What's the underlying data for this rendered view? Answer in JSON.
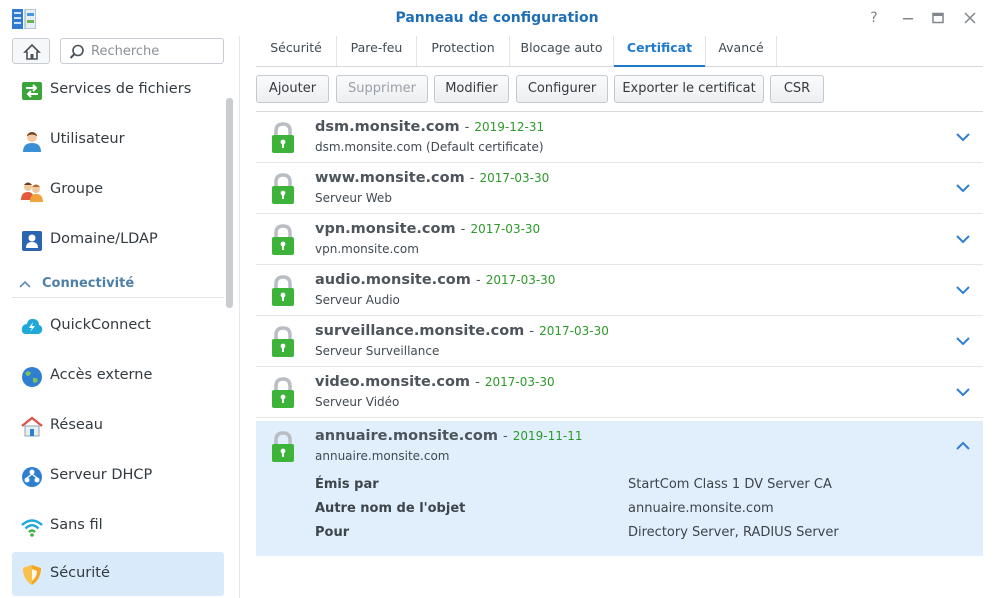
{
  "window": {
    "title": "Panneau de configuration",
    "help_icon": "question-icon",
    "minimize_icon": "minimize-icon",
    "maximize_icon": "maximize-icon",
    "close_icon": "close-icon"
  },
  "sidebar": {
    "search_placeholder": "Recherche",
    "items": [
      {
        "label": "Services de fichiers",
        "icon": "file-services-icon"
      },
      {
        "label": "Utilisateur",
        "icon": "user-icon"
      },
      {
        "label": "Groupe",
        "icon": "group-icon"
      },
      {
        "label": "Domaine/LDAP",
        "icon": "domain-ldap-icon"
      },
      {
        "label": "QuickConnect",
        "icon": "quickconnect-icon"
      },
      {
        "label": "Accès externe",
        "icon": "external-access-icon"
      },
      {
        "label": "Réseau",
        "icon": "network-icon"
      },
      {
        "label": "Serveur DHCP",
        "icon": "dhcp-server-icon"
      },
      {
        "label": "Sans fil",
        "icon": "wireless-icon"
      },
      {
        "label": "Sécurité",
        "icon": "security-icon"
      }
    ],
    "section_label": "Connectivité",
    "active_item": "Sécurité"
  },
  "tabs": [
    {
      "label": "Sécurité"
    },
    {
      "label": "Pare-feu"
    },
    {
      "label": "Protection"
    },
    {
      "label": "Blocage auto"
    },
    {
      "label": "Certificat"
    },
    {
      "label": "Avancé"
    }
  ],
  "active_tab": "Certificat",
  "toolbar": {
    "add": "Ajouter",
    "delete": "Supprimer",
    "modify": "Modifier",
    "configure": "Configurer",
    "export": "Exporter le certificat",
    "csr": "CSR"
  },
  "certificates": [
    {
      "name": "dsm.monsite.com",
      "sep": "-",
      "date": "2019-12-31",
      "sub": "dsm.monsite.com   (Default certificate)"
    },
    {
      "name": "www.monsite.com",
      "sep": "-",
      "date": "2017-03-30",
      "sub": "Serveur Web"
    },
    {
      "name": "vpn.monsite.com",
      "sep": "-",
      "date": "2017-03-30",
      "sub": "vpn.monsite.com"
    },
    {
      "name": "audio.monsite.com",
      "sep": "-",
      "date": "2017-03-30",
      "sub": "Serveur Audio"
    },
    {
      "name": "surveillance.monsite.com",
      "sep": "-",
      "date": "2017-03-30",
      "sub": "Serveur Surveillance"
    },
    {
      "name": "video.monsite.com",
      "sep": "-",
      "date": "2017-03-30",
      "sub": "Serveur Vidéo"
    },
    {
      "name": "annuaire.monsite.com",
      "sep": "-",
      "date": "2019-11-11",
      "sub": "annuaire.monsite.com"
    }
  ],
  "expanded_details": {
    "issuer_label": "Émis par",
    "issuer_value": "StartCom Class 1 DV Server CA",
    "san_label": "Autre nom de l'objet",
    "san_value": "annuaire.monsite.com",
    "for_label": "Pour",
    "for_value": "Directory Server, RADIUS Server"
  },
  "colors": {
    "accent": "#1f7acd",
    "date_green": "#2d9a2a",
    "lock_green": "#3db33a",
    "selected_row": "#e1effc"
  }
}
